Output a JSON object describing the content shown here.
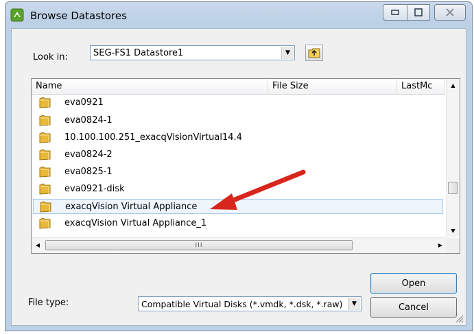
{
  "window": {
    "title": "Browse Datastores",
    "min_glyph": "▭",
    "max_glyph": "▢",
    "close_glyph": "✕"
  },
  "look_in": {
    "label": "Look in:",
    "value": "SEG-FS1 Datastore1"
  },
  "file_list": {
    "columns": [
      "Name",
      "File Size",
      "LastMc"
    ],
    "rows": [
      {
        "name": "eva0921"
      },
      {
        "name": "eva0824-1"
      },
      {
        "name": "10.100.100.251_exacqVisionVirtual14.4"
      },
      {
        "name": "eva0824-2"
      },
      {
        "name": "eva0825-1"
      },
      {
        "name": "eva0921-disk"
      },
      {
        "name": "exacqVision Virtual Appliance",
        "selected": true
      },
      {
        "name": "exacqVision Virtual Appliance_1"
      }
    ],
    "hscroll_thumb_grip": "III"
  },
  "file_type": {
    "label": "File type:",
    "value": "Compatible Virtual Disks (*.vmdk, *.dsk, *.raw)"
  },
  "buttons": {
    "open": "Open",
    "cancel": "Cancel"
  },
  "colors": {
    "folder": "#e8b93a",
    "arrow": "#d9261c",
    "selection": "#eef5fd"
  }
}
